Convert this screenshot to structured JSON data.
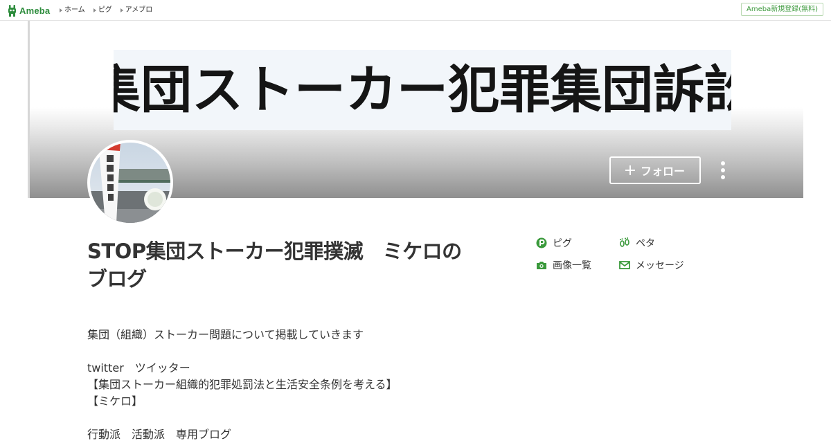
{
  "header": {
    "logo_text": "Ameba",
    "nav": [
      {
        "label": "ホーム"
      },
      {
        "label": "ピグ"
      },
      {
        "label": "アメブロ"
      }
    ],
    "signup_label": "Ameba新規登録(無料)"
  },
  "cover": {
    "title_text": "集団ストーカー犯罪集団訴訟"
  },
  "profile": {
    "follow_label": "フォロー",
    "blog_title": "STOP集団ストーカー犯罪撲滅　ミケロのブログ",
    "links": [
      {
        "label": "ピグ",
        "icon": "pigg-icon"
      },
      {
        "label": "ペタ",
        "icon": "footprint-icon"
      },
      {
        "label": "画像一覧",
        "icon": "camera-icon"
      },
      {
        "label": "メッセージ",
        "icon": "mail-icon"
      }
    ],
    "description": [
      "集団（組織）ストーカー問題について掲載していきます",
      "",
      "twitter　ツイッター",
      "【集団ストーカー組織的犯罪処罰法と生活安全条例を考える】",
      "【ミケロ】",
      "",
      "行動派　活動派　専用ブログ"
    ]
  },
  "colors": {
    "brand_green": "#2d8c3c",
    "icon_green": "#3b9a3c",
    "text": "#333333"
  }
}
